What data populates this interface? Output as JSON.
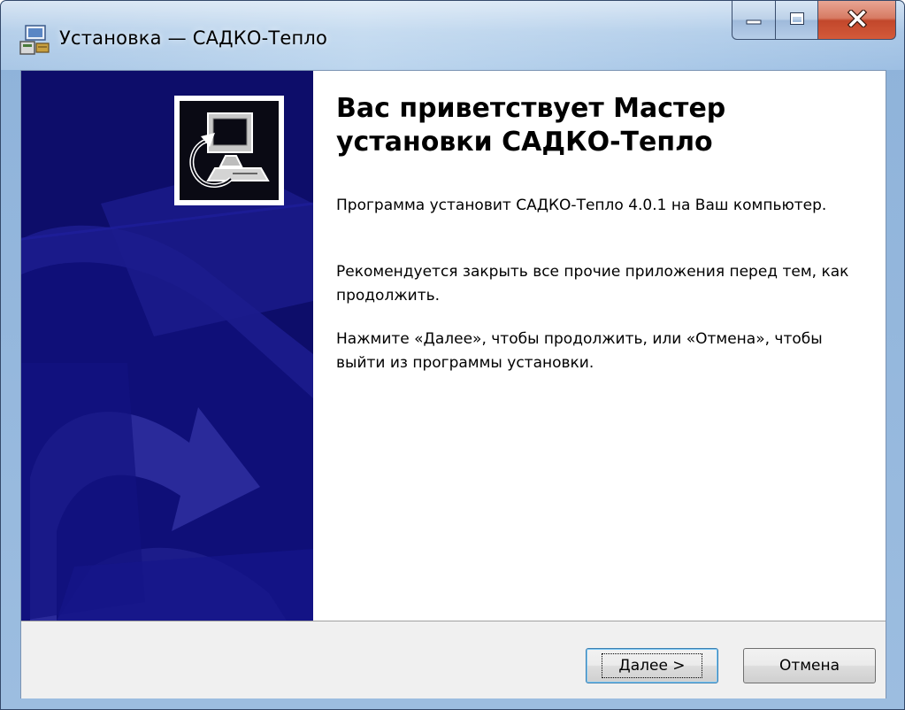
{
  "window": {
    "title": "Установка — САДКО-Тепло",
    "icon": "setup-installer-icon"
  },
  "caption_buttons": {
    "minimize_icon": "minimize-icon",
    "maximize_icon": "maximize-icon",
    "close_icon": "close-icon",
    "close_color": "#c7452a"
  },
  "side_panel": {
    "background_color": "#0d0d6a",
    "logo_icon": "computer-install-icon"
  },
  "content": {
    "heading": "Вас приветствует Мастер установки САДКО-Тепло",
    "paragraphs": [
      "Программа установит САДКО-Тепло 4.0.1 на Ваш компьютер.",
      "Рекомендуется закрыть все прочие приложения перед тем, как продолжить.",
      "Нажмите «Далее», чтобы продолжить, или «Отмена», чтобы выйти из программы установки."
    ]
  },
  "buttons": {
    "next_label": "Далее >",
    "cancel_label": "Отмена"
  }
}
